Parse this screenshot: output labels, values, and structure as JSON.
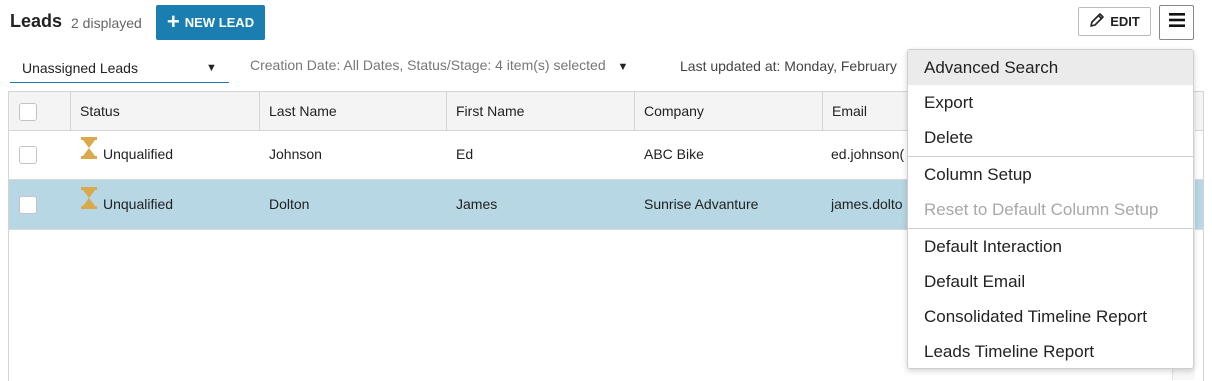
{
  "header": {
    "title": "Leads",
    "count": "2 displayed",
    "new_lead_label": "NEW LEAD",
    "edit_label": "EDIT"
  },
  "filters": {
    "view": "Unassigned Leads",
    "criteria": "Creation Date: All Dates, Status/Stage: 4 item(s) selected",
    "last_updated": "Last updated at: Monday, February"
  },
  "table": {
    "columns": [
      "Status",
      "Last Name",
      "First Name",
      "Company",
      "Email"
    ],
    "rows": [
      {
        "status": "Unqualified",
        "last_name": "Johnson",
        "first_name": "Ed",
        "company": "ABC Bike",
        "email": "ed.johnson(",
        "selected": false
      },
      {
        "status": "Unqualified",
        "last_name": "Dolton",
        "first_name": "James",
        "company": "Sunrise Advanture",
        "email": "james.dolto",
        "selected": true
      }
    ]
  },
  "menu": {
    "items": [
      {
        "label": "Advanced Search",
        "state": "hover"
      },
      {
        "label": "Export",
        "state": "normal"
      },
      {
        "label": "Delete",
        "state": "normal"
      },
      {
        "label": "Column Setup",
        "state": "normal"
      },
      {
        "label": "Reset to Default Column Setup",
        "state": "disabled"
      },
      {
        "label": "Default Interaction",
        "state": "normal"
      },
      {
        "label": "Default Email",
        "state": "normal"
      },
      {
        "label": "Consolidated Timeline Report",
        "state": "normal"
      },
      {
        "label": "Leads Timeline Report",
        "state": "normal"
      }
    ]
  },
  "colors": {
    "accent": "#1a7fb0",
    "selected_row": "#b6d7e3",
    "status_icon": "#d9a94a",
    "menu_hover": "#ebebeb"
  },
  "icons": {
    "new_lead": "plus-icon",
    "edit": "pencil-icon",
    "menu": "hamburger-icon",
    "status": "hourglass-icon",
    "dropdown": "caret-down-icon"
  }
}
